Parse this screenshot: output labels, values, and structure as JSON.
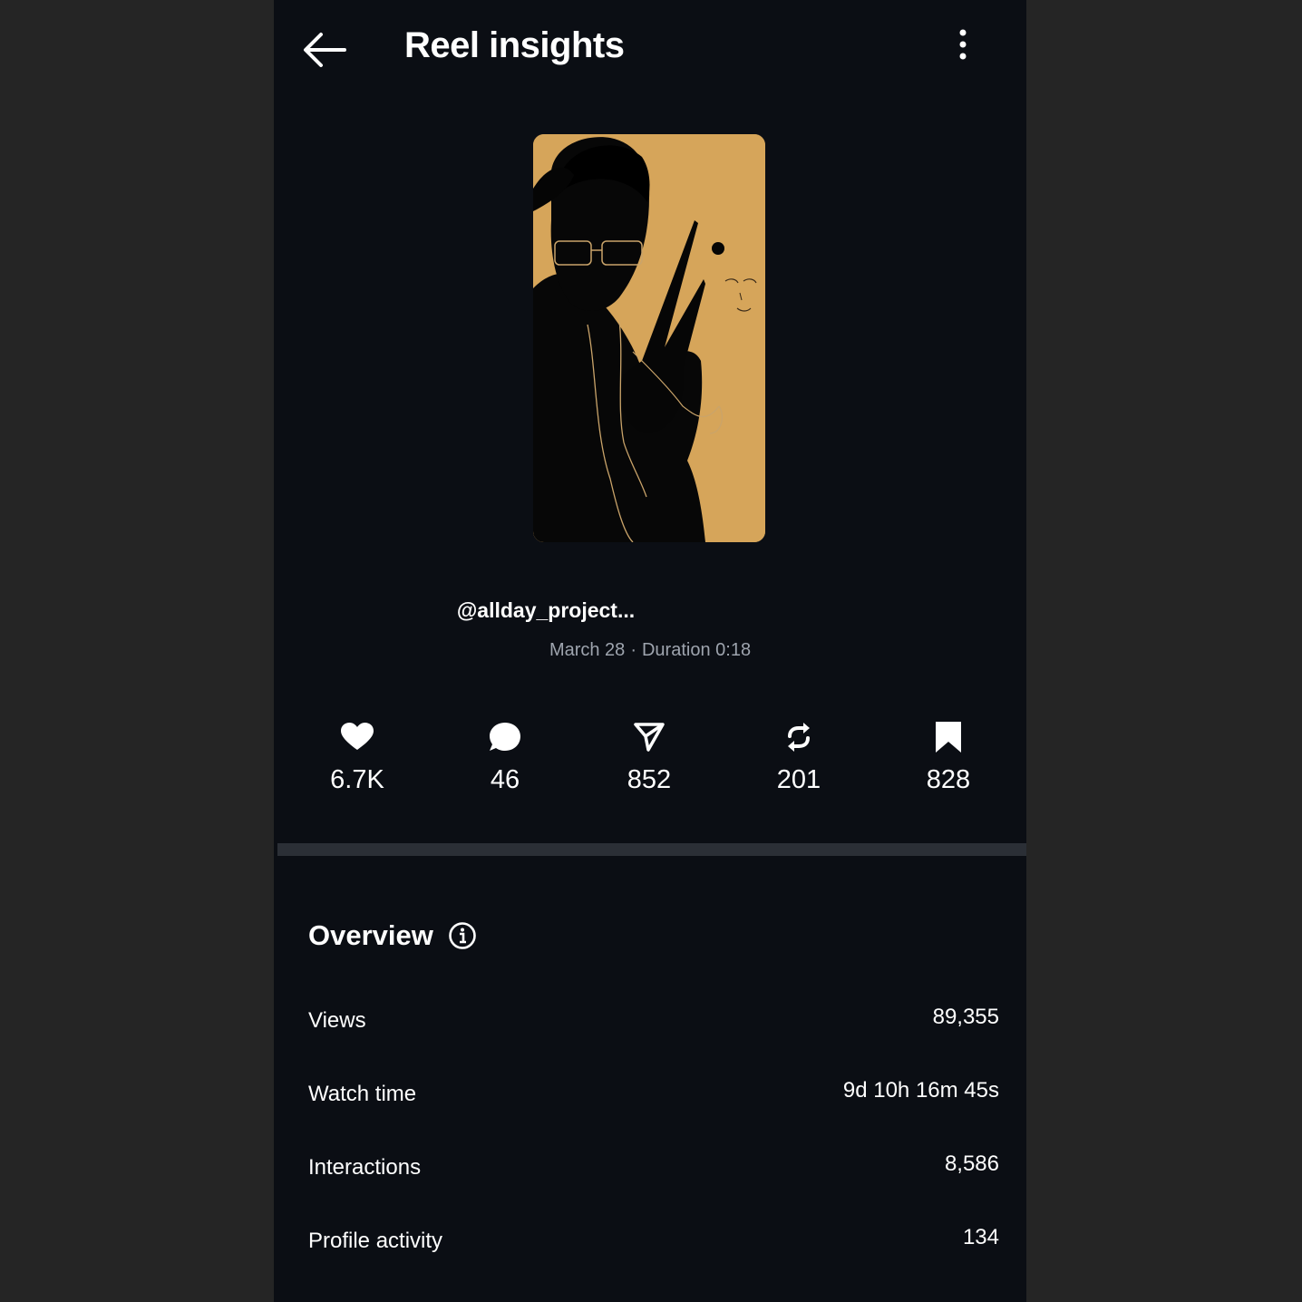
{
  "header": {
    "title": "Reel insights",
    "back_icon": "arrow-left-icon",
    "more_icon": "more-vertical-icon"
  },
  "reel": {
    "handle": "@allday_project...",
    "date": "March 28",
    "separator": "·",
    "duration": "Duration 0:18"
  },
  "stats": [
    {
      "icon": "heart-icon",
      "value": "6.7K"
    },
    {
      "icon": "comment-icon",
      "value": "46"
    },
    {
      "icon": "share-icon",
      "value": "852"
    },
    {
      "icon": "repost-icon",
      "value": "201"
    },
    {
      "icon": "bookmark-icon",
      "value": "828"
    }
  ],
  "overview": {
    "title": "Overview",
    "rows": [
      {
        "label": "Views",
        "value": "89,355"
      },
      {
        "label": "Watch time",
        "value": "9d 10h 16m 45s"
      },
      {
        "label": "Interactions",
        "value": "8,586"
      },
      {
        "label": "Profile activity",
        "value": "134"
      }
    ]
  },
  "colors": {
    "background": "#252525",
    "panel": "#0b0e14",
    "thumbnail": "#d6a55a",
    "muted_text": "#9ea4ae"
  }
}
